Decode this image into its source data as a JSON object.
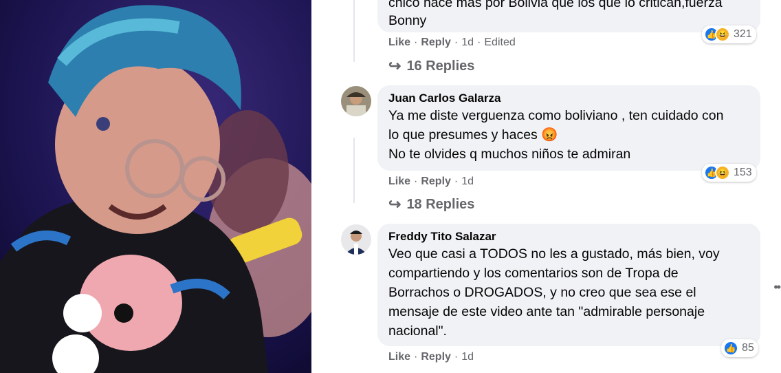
{
  "comments": [
    {
      "text_lines": [
        "chico hace más por Bolivia que los que lo critican,fuerza",
        "Bonny"
      ],
      "actions": {
        "like": "Like",
        "reply": "Reply",
        "time": "1d",
        "edited": "Edited"
      },
      "reactions": {
        "icons": [
          "like-icon",
          "haha-icon"
        ],
        "count": "321"
      },
      "replies_label": "16 Replies"
    },
    {
      "author": "Juan Carlos Galarza",
      "text_lines": [
        "Ya me diste verguenza como boliviano , ten cuidado con",
        "lo que presumes y haces",
        "No te olvides q muchos niños te admiran"
      ],
      "emoji": "😡",
      "actions": {
        "like": "Like",
        "reply": "Reply",
        "time": "1d"
      },
      "reactions": {
        "icons": [
          "like-icon",
          "haha-icon"
        ],
        "count": "153"
      },
      "replies_label": "18 Replies"
    },
    {
      "author": "Freddy Tito Salazar",
      "text_lines": [
        "Veo que casi a TODOS no les a gustado, más bien, voy",
        "compartiendo y los comentarios son de Tropa de",
        "Borrachos o DROGADOS, y no creo que sea ese el",
        "mensaje de este video ante tan \"admirable personaje",
        "nacional\"."
      ],
      "actions": {
        "like": "Like",
        "reply": "Reply",
        "time": "1d"
      },
      "reactions": {
        "icons": [
          "like-icon"
        ],
        "count": "85"
      }
    }
  ],
  "colors": {
    "accent": "#1877f2",
    "bubble": "#f0f2f5",
    "muted": "#65676b"
  }
}
